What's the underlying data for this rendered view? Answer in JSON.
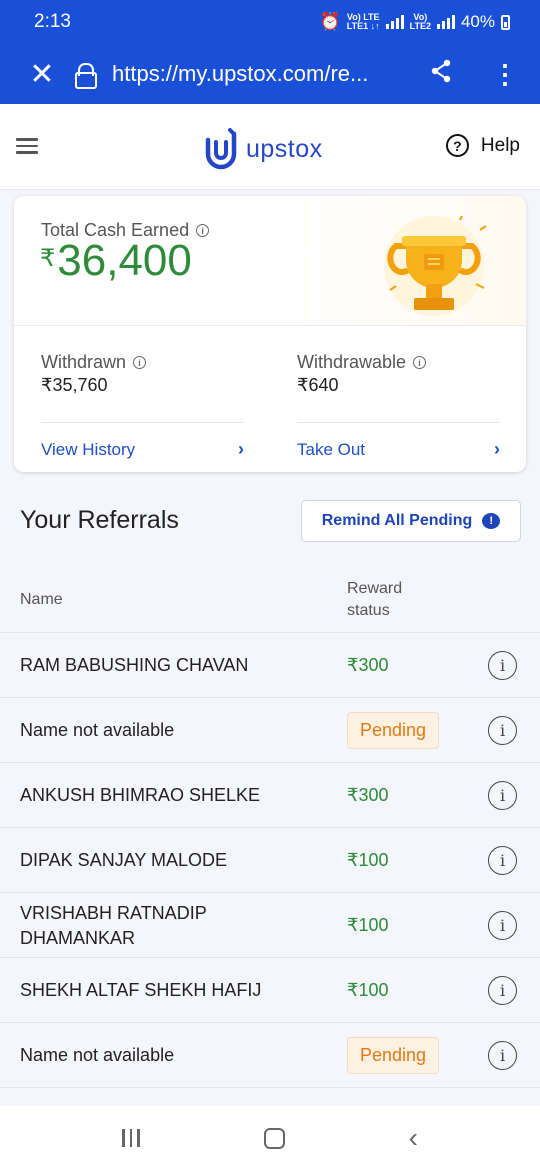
{
  "status_bar": {
    "time": "2:13",
    "net1_top": "Vo) LTE",
    "net1_bottom": "LTE1 ↓↑",
    "net2_top": "Vo)",
    "net2_bottom": "LTE2",
    "battery": "40%"
  },
  "browser": {
    "url": "https://my.upstox.com/re..."
  },
  "header": {
    "brand": "upstox",
    "help_label": "Help"
  },
  "earnings": {
    "total_label": "Total Cash Earned",
    "currency": "₹",
    "total_value": "36,400",
    "withdrawn_label": "Withdrawn",
    "withdrawn_value": "₹35,760",
    "withdrawable_label": "Withdrawable",
    "withdrawable_value": "₹640",
    "view_history": "View History",
    "take_out": "Take Out"
  },
  "referrals": {
    "title": "Your Referrals",
    "remind_label": "Remind All Pending",
    "col_name": "Name",
    "col_status": "Reward status",
    "rows": [
      {
        "name": "RAM BABUSHING CHAVAN",
        "status": "₹300"
      },
      {
        "name": "Name not available",
        "status": "Pending"
      },
      {
        "name": "ANKUSH BHIMRAO SHELKE",
        "status": "₹300"
      },
      {
        "name": "DIPAK SANJAY MALODE",
        "status": "₹100"
      },
      {
        "name": "VRISHABH RATNADIP DHAMANKAR",
        "status": "₹100"
      },
      {
        "name": "SHEKH ALTAF SHEKH HAFIJ",
        "status": "₹100"
      },
      {
        "name": "Name not available",
        "status": "Pending"
      }
    ]
  },
  "colors": {
    "brand_blue": "#1a4fd8",
    "reward_green": "#2e8b3a",
    "pending_orange": "#e07a14"
  }
}
